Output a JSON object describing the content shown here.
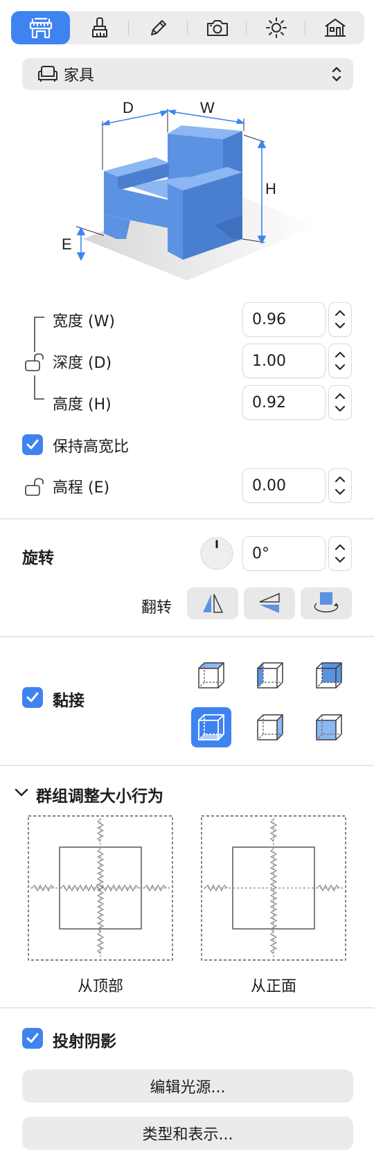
{
  "tabs": [
    {
      "icon": "ruler-tool-icon",
      "active": true
    },
    {
      "icon": "brush-icon",
      "active": false
    },
    {
      "icon": "pencil-icon",
      "active": false
    },
    {
      "icon": "camera-icon",
      "active": false
    },
    {
      "icon": "sun-icon",
      "active": false
    },
    {
      "icon": "house-icon",
      "active": false
    }
  ],
  "category": {
    "icon": "armchair-icon",
    "label": "家具"
  },
  "diagram": {
    "label_d": "D",
    "label_w": "W",
    "label_h": "H",
    "label_e": "E"
  },
  "dimensions": {
    "width": {
      "label": "宽度 (W)",
      "value": "0.96"
    },
    "depth": {
      "label": "深度 (D)",
      "value": "1.00"
    },
    "height": {
      "label": "高度 (H)",
      "value": "0.92"
    },
    "keep_ratio": {
      "label": "保持高宽比",
      "checked": true
    },
    "elevation": {
      "label": "高程 (E)",
      "value": "0.00"
    }
  },
  "rotation": {
    "title": "旋转",
    "value": "0°",
    "flip_label": "翻转"
  },
  "snap": {
    "label": "黏接",
    "checked": true,
    "active_index": 3
  },
  "group_resize": {
    "title": "群组调整大小行为",
    "from_top": "从顶部",
    "from_front": "从正面"
  },
  "shadow": {
    "label": "投射阴影",
    "checked": true
  },
  "buttons": {
    "edit_light": "编辑光源...",
    "type_display": "类型和表示..."
  },
  "colors": {
    "accent": "#3f83f0",
    "furniture": "#5b93e2"
  }
}
